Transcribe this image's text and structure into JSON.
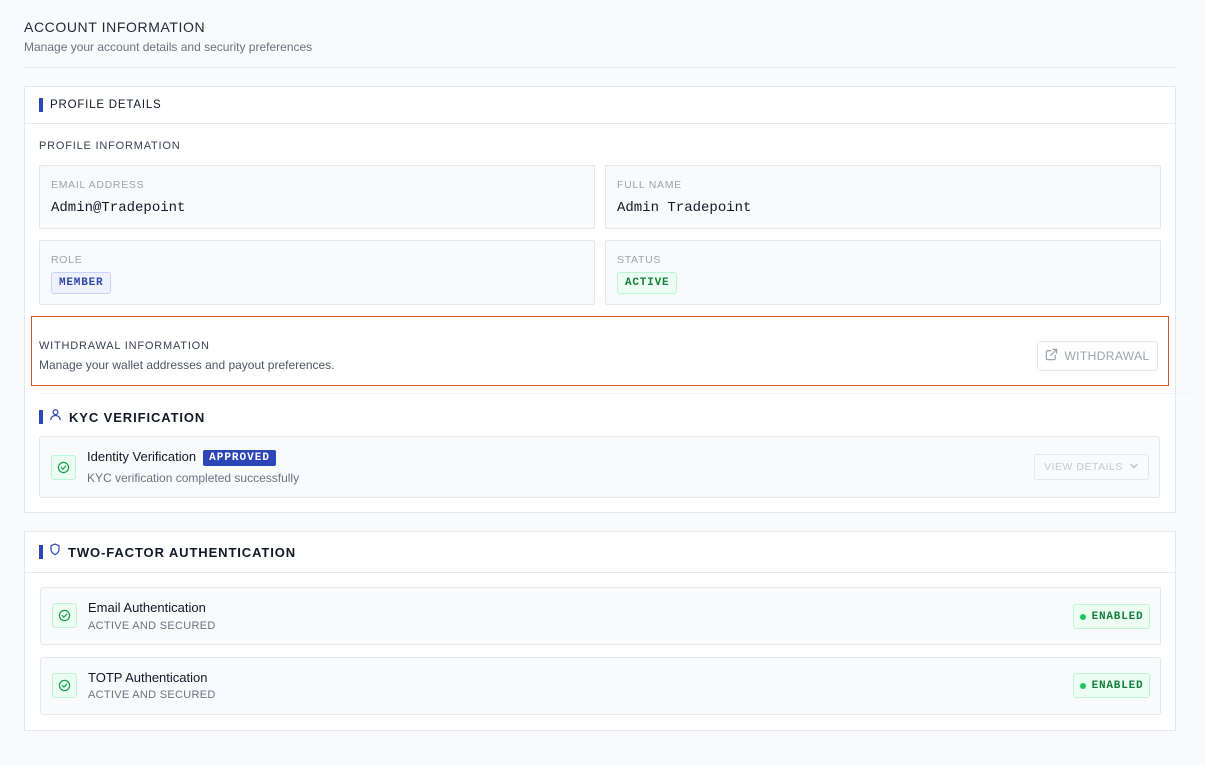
{
  "header": {
    "title": "ACCOUNT INFORMATION",
    "subtitle": "Manage your account details and security preferences"
  },
  "profile_card": {
    "title": "PROFILE DETAILS",
    "section_label": "PROFILE INFORMATION",
    "email": {
      "label": "EMAIL ADDRESS",
      "value": "Admin@Tradepoint"
    },
    "full_name": {
      "label": "FULL NAME",
      "value": "Admin Tradepoint"
    },
    "role": {
      "label": "ROLE",
      "value": "MEMBER"
    },
    "status": {
      "label": "STATUS",
      "value": "ACTIVE"
    },
    "withdrawal": {
      "title": "WITHDRAWAL INFORMATION",
      "description": "Manage your wallet addresses and payout preferences.",
      "button_label": "WITHDRAWAL",
      "button_icon": "external-link-icon"
    },
    "kyc": {
      "title": "KYC VERIFICATION",
      "icon": "user-icon",
      "item_title": "Identity Verification",
      "badge": "APPROVED",
      "item_subtitle": "KYC verification completed successfully",
      "details_label": "VIEW DETAILS"
    }
  },
  "two_factor": {
    "title": "TWO-FACTOR AUTHENTICATION",
    "icon": "shield-icon",
    "items": [
      {
        "title": "Email Authentication",
        "subtitle": "ACTIVE AND SECURED",
        "status": "ENABLED"
      },
      {
        "title": "TOTP Authentication",
        "subtitle": "ACTIVE AND SECURED",
        "status": "ENABLED"
      }
    ]
  },
  "colors": {
    "accent": "#2c46b8",
    "success": "#22c55e",
    "highlight_border": "#d9562c"
  }
}
